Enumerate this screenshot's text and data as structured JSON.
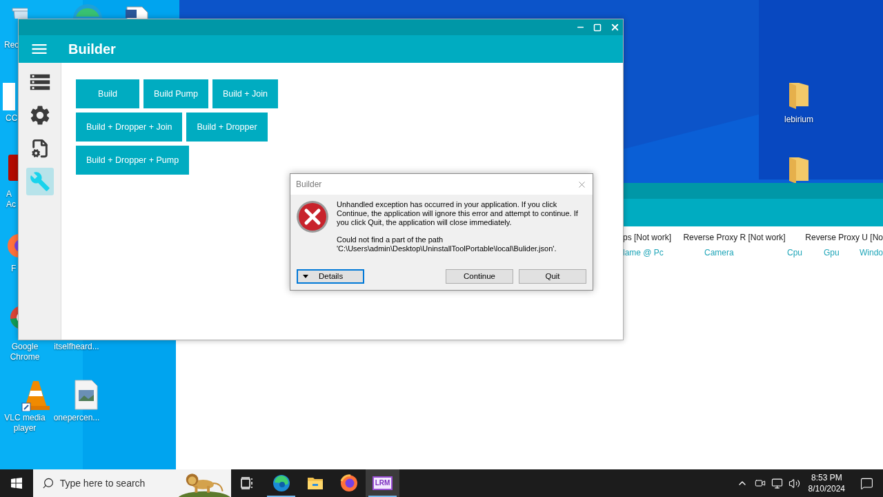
{
  "desktop": {
    "icons": [
      {
        "kind": "recycle-bin",
        "lines": [
          "Rec"
        ]
      },
      {
        "kind": "shortcut-doc",
        "lines": [
          "CC"
        ]
      },
      {
        "kind": "acrobat",
        "lines": [
          "A",
          "Ac"
        ]
      },
      {
        "kind": "firefox",
        "lines": [
          "F"
        ]
      },
      {
        "kind": "chrome",
        "lines": [
          "Google",
          "Chrome"
        ]
      },
      {
        "kind": "blank",
        "lines": [
          "itselfheard..."
        ]
      },
      {
        "kind": "vlc",
        "lines": [
          "VLC media",
          "player"
        ]
      },
      {
        "kind": "image-file",
        "lines": [
          "onepercen..."
        ]
      },
      {
        "kind": "edge"
      },
      {
        "kind": "word-doc"
      },
      {
        "kind": "folder",
        "lines": [
          "lebirium"
        ]
      },
      {
        "kind": "folder"
      }
    ]
  },
  "background_window": {
    "tabs": [
      "ps [Not work]",
      "Reverse Proxy R [Not work]",
      "Reverse Proxy U [No"
    ],
    "columns": [
      "lame @ Pc",
      "Camera",
      "Cpu",
      "Gpu",
      "Windo"
    ]
  },
  "builder_window": {
    "title": "Builder",
    "sidebar": [
      {
        "kind": "server",
        "selected": false
      },
      {
        "kind": "gear",
        "selected": false
      },
      {
        "kind": "file-gear",
        "selected": false
      },
      {
        "kind": "wrench",
        "selected": true
      }
    ],
    "button_rows": [
      [
        "Build",
        "Build Pump",
        "Build + Join"
      ],
      [
        "Build + Dropper + Join",
        "Build + Dropper"
      ],
      [
        "Build + Dropper + Pump"
      ]
    ]
  },
  "dialog": {
    "title": "Builder",
    "message": "Unhandled exception has occurred in your application. If you click Continue, the application will ignore this error and attempt to continue. If you click Quit, the application will close immediately.",
    "detail": "Could not find a part of the path 'C:\\Users\\admin\\Desktop\\UninstallToolPortable\\local\\Bulider.json'.",
    "details_button": {
      "label": "Details",
      "focused": true
    },
    "buttons": [
      "Continue",
      "Quit"
    ]
  },
  "taskbar": {
    "search": {
      "placeholder": "Type here to search"
    },
    "apps": [
      {
        "kind": "edge",
        "running": true,
        "selected": false
      },
      {
        "kind": "folder",
        "running": false,
        "selected": false
      },
      {
        "kind": "firefox",
        "running": false,
        "selected": false
      },
      {
        "kind": "logo",
        "label": "LRM",
        "running": true,
        "selected": true
      }
    ],
    "time": "8:53 PM",
    "date": "8/10/2024"
  }
}
